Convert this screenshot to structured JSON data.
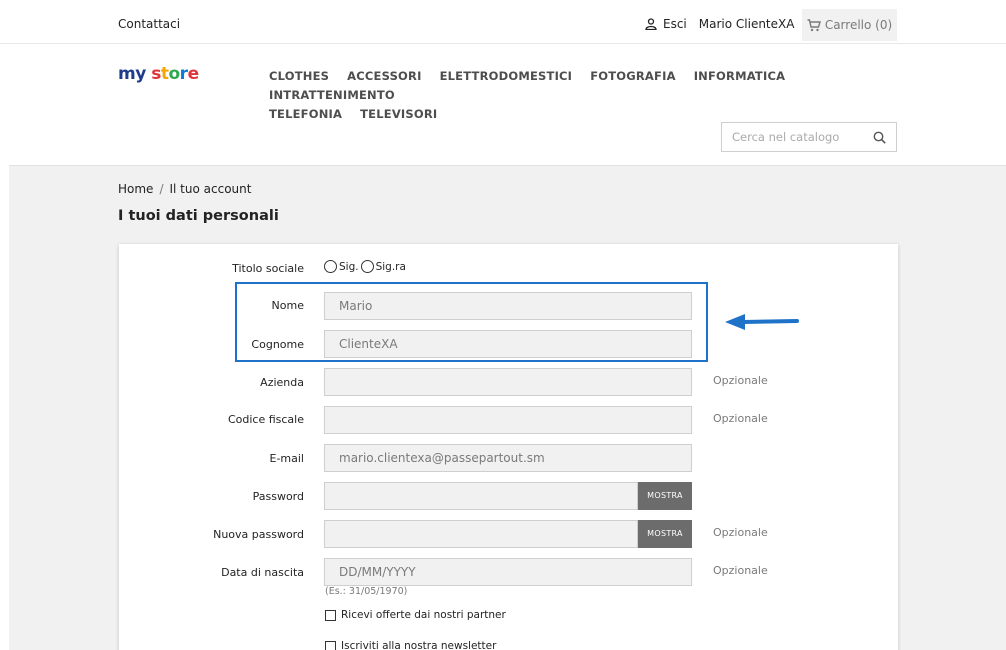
{
  "topbar": {
    "contact": "Contattaci",
    "logout": "Esci",
    "user_name": "Mario ClienteXA",
    "cart": "Carrello (0)"
  },
  "logo": {
    "part1": "my",
    "part2": "store"
  },
  "nav": {
    "items": [
      "CLOTHES",
      "ACCESSORI",
      "ELETTRODOMESTICI",
      "FOTOGRAFIA",
      "INFORMATICA",
      "INTRATTENIMENTO",
      "TELEFONIA",
      "TELEVISORI"
    ]
  },
  "search": {
    "placeholder": "Cerca nel catalogo"
  },
  "breadcrumb": {
    "home": "Home",
    "sep": "/",
    "current": "Il tuo account"
  },
  "page_title": "I tuoi dati personali",
  "form": {
    "title_label": "Titolo sociale",
    "title_options": [
      "Sig.",
      "Sig.ra"
    ],
    "first_name_label": "Nome",
    "first_name_value": "Mario",
    "last_name_label": "Cognome",
    "last_name_value": "ClienteXA",
    "company_label": "Azienda",
    "tax_code_label": "Codice fiscale",
    "email_label": "E-mail",
    "email_value": "mario.clientexa@passepartout.sm",
    "password_label": "Password",
    "new_password_label": "Nuova password",
    "show_button": "MOSTRA",
    "birthdate_label": "Data di nascita",
    "birthdate_placeholder": "DD/MM/YYYY",
    "birthdate_hint": "(Es.: 31/05/1970)",
    "optional_label": "Opzionale",
    "partner_offers": "Ricevi offerte dai nostri partner",
    "newsletter": "Iscriviti alla nostra newsletter"
  },
  "colors": {
    "highlight": "#1e72c8",
    "show_button": "#6c6c6c"
  }
}
